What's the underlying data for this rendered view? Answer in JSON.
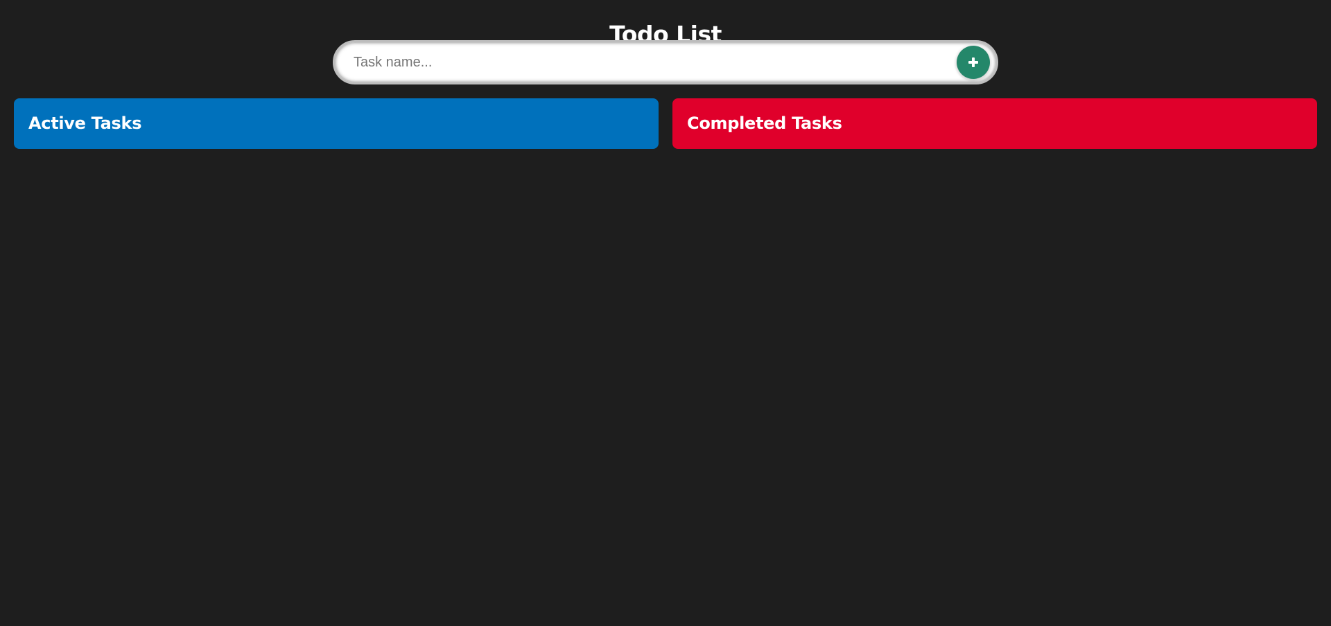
{
  "header": {
    "title": "Todo List"
  },
  "add_task": {
    "input_value": "",
    "placeholder": "Task name...",
    "button_icon": "plus-icon"
  },
  "panels": [
    {
      "title": "Active Tasks",
      "color": "#0071bc",
      "tasks": []
    },
    {
      "title": "Completed Tasks",
      "color": "#e0002b",
      "tasks": []
    }
  ],
  "colors": {
    "background": "#1e1e1e",
    "add_button": "#24876a",
    "text": "#ffffff"
  }
}
